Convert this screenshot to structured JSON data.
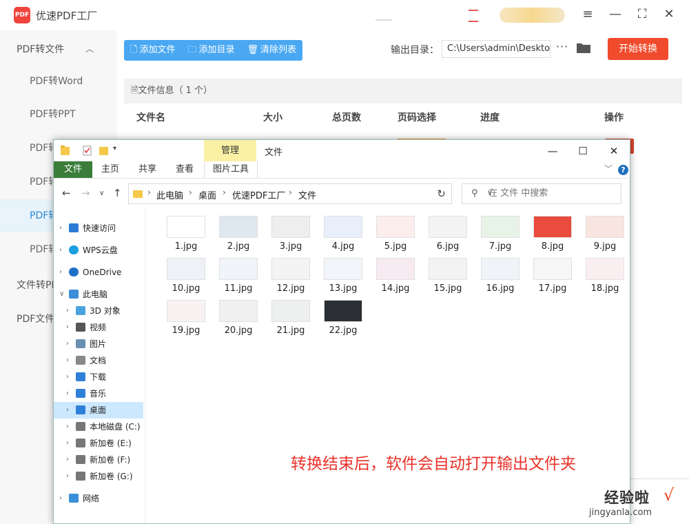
{
  "app": {
    "logo_text": "PDF",
    "title": "优速PDF工厂",
    "window_controls": [
      "menu-icon",
      "minimize-icon",
      "maximize-icon",
      "close-icon"
    ]
  },
  "sidebar": {
    "group1": "PDF转文件",
    "items": [
      {
        "label": "PDF转Word"
      },
      {
        "label": "PDF转PPT"
      },
      {
        "label": "PDF转"
      },
      {
        "label": "PDF转"
      },
      {
        "label": "PDF转"
      },
      {
        "label": "PDF转"
      }
    ],
    "group2": "文件转PD",
    "group3": "PDF文件"
  },
  "toolbar": {
    "add_file": "添加文件",
    "add_dir": "添加目录",
    "clear_list": "清除列表",
    "output_label": "输出目录：",
    "output_path": "C:\\Users\\admin\\Deskto",
    "more": "···",
    "start": "开始转换"
  },
  "file_info": "文件信息（ 1 个）",
  "columns": [
    "文件名",
    "大小",
    "总页数",
    "页码选择",
    "进度",
    "操作"
  ],
  "explorer": {
    "manage_tab": "管理",
    "title": "文件",
    "ribbon_tabs": [
      "文件",
      "主页",
      "共享",
      "查看"
    ],
    "pic_tools": "图片工具",
    "breadcrumb": [
      "此电脑",
      "桌面",
      "优速PDF工厂",
      "文件"
    ],
    "search_placeholder": "在 文件 中搜索",
    "nav": [
      {
        "label": "快速访问",
        "icon": "star-icon"
      },
      {
        "label": "WPS云盘",
        "icon": "cloud-icon"
      },
      {
        "label": "OneDrive",
        "icon": "onedrive-icon"
      },
      {
        "label": "此电脑",
        "icon": "computer-icon"
      },
      {
        "label": "3D 对象",
        "icon": "cube-icon"
      },
      {
        "label": "视频",
        "icon": "video-icon"
      },
      {
        "label": "图片",
        "icon": "picture-icon"
      },
      {
        "label": "文档",
        "icon": "document-icon"
      },
      {
        "label": "下载",
        "icon": "download-icon"
      },
      {
        "label": "音乐",
        "icon": "music-icon"
      },
      {
        "label": "桌面",
        "icon": "desktop-icon"
      },
      {
        "label": "本地磁盘 (C:)",
        "icon": "drive-icon"
      },
      {
        "label": "新加卷 (E:)",
        "icon": "drive-icon"
      },
      {
        "label": "新加卷 (F:)",
        "icon": "drive-icon"
      },
      {
        "label": "新加卷 (G:)",
        "icon": "drive-icon"
      },
      {
        "label": "网络",
        "icon": "network-icon"
      }
    ],
    "files": [
      "1.jpg",
      "2.jpg",
      "3.jpg",
      "4.jpg",
      "5.jpg",
      "6.jpg",
      "7.jpg",
      "8.jpg",
      "9.jpg",
      "10.jpg",
      "11.jpg",
      "12.jpg",
      "13.jpg",
      "14.jpg",
      "15.jpg",
      "16.jpg",
      "17.jpg",
      "18.jpg",
      "19.jpg",
      "20.jpg",
      "21.jpg",
      "22.jpg"
    ]
  },
  "notice": "转换结束后，软件会自动打开输出文件夹",
  "watermark": {
    "main": "经验啦",
    "sub": "jingyanla.com",
    "check": "√"
  },
  "colors": {
    "accent": "#4aa8f2",
    "start": "#f04b2c",
    "notice": "#e8312a",
    "active_bg": "#e8f3fb"
  }
}
